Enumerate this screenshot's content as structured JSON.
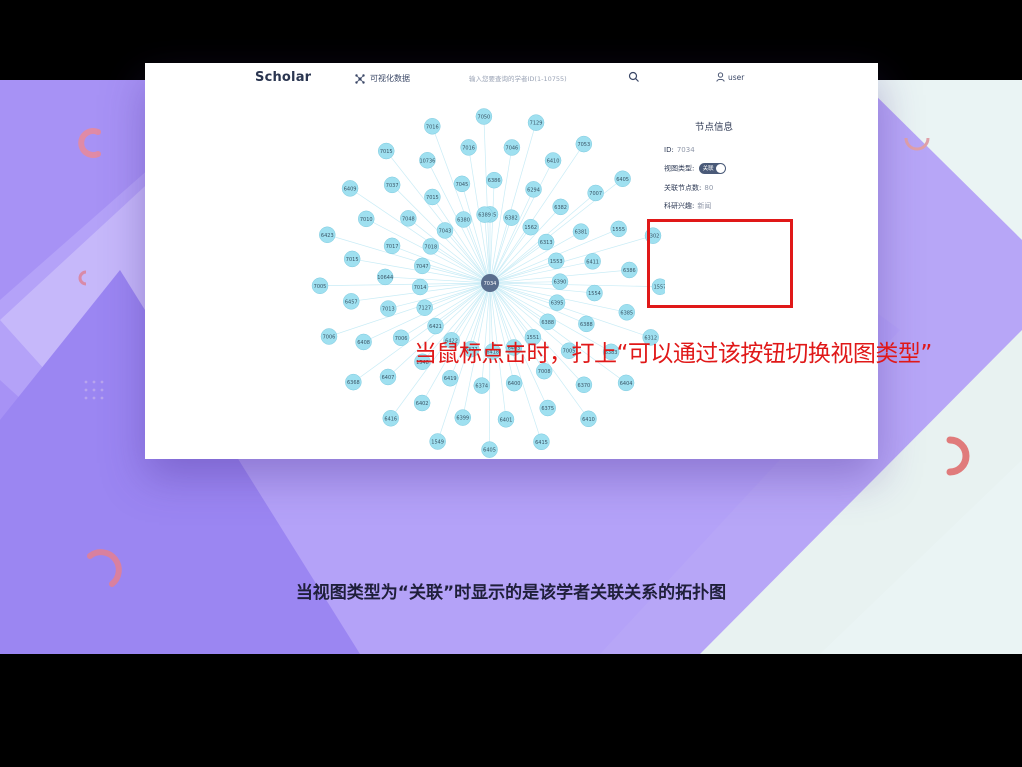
{
  "header": {
    "brand": "Scholar",
    "nav_visualize": "可视化数据",
    "search_placeholder": "输入您要查询的学者ID(1-10755)",
    "user": "user"
  },
  "panel": {
    "title": "节点信息",
    "id_label": "ID:",
    "id_value": "7034",
    "view_type_label": "视图类型:",
    "view_type_toggle": "关联",
    "related_label": "关联节点数:",
    "related_value": "80",
    "interest_label": "科研兴趣:",
    "interest_value": "新闻"
  },
  "annotation": "当鼠标点击时，打上“可以通过该按钮切换视图类型”",
  "caption": "当视图类型为“关联”时显示的是该学者关联关系的拓扑图",
  "graph": {
    "center": "7034",
    "node_color": "#9fe0f0",
    "edge_color": "#c9ecf6",
    "nodes": [
      "6385",
      "6294",
      "7007",
      "6302",
      "6382",
      "6382",
      "1555",
      "1557",
      "1562",
      "6381",
      "6386",
      "6312",
      "6313",
      "6411",
      "6385",
      "6404",
      "1553",
      "1554",
      "6383",
      "6410",
      "6390",
      "6388",
      "6370",
      "6415",
      "6395",
      "7005",
      "6375",
      "6405",
      "6388",
      "7008",
      "6401",
      "1549",
      "1551",
      "6400",
      "6399",
      "6416",
      "6403",
      "6374",
      "6402",
      "6368",
      "6418",
      "6419",
      "6407",
      "7006",
      "6377",
      "1548",
      "6408",
      "7005",
      "6422",
      "7006",
      "6457",
      "6423",
      "6421",
      "7013",
      "7015",
      "6409",
      "7127",
      "10644",
      "7010",
      "7015",
      "7014",
      "7017",
      "7037",
      "7016",
      "7047",
      "7048",
      "10736",
      "7050",
      "7018",
      "7015",
      "7016",
      "7129",
      "7043",
      "7045",
      "7046",
      "7053",
      "6380",
      "6386",
      "6410",
      "6405",
      "6389"
    ]
  }
}
